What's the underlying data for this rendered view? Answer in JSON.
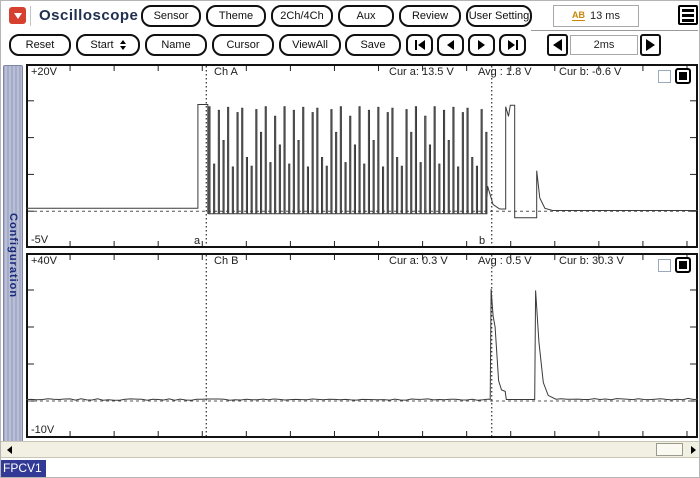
{
  "window": {
    "title": "Oscilloscope"
  },
  "toolbar_top": {
    "buttons": [
      "Sensor",
      "Theme",
      "2Ch/4Ch",
      "Aux",
      "Review",
      "User Setting"
    ],
    "time_display": {
      "icon_text": "AB",
      "value": "13 ms"
    }
  },
  "toolbar_second": {
    "buttons": [
      "Reset",
      "Start",
      "Name",
      "Cursor",
      "ViewAll",
      "Save"
    ],
    "timebase_value": "2ms"
  },
  "sidebar": {
    "tab_label": "Configuration"
  },
  "channels": [
    {
      "name": "Ch A",
      "v_top_label": "+20V",
      "v_bottom_label": "-5V",
      "cur_a_label": "Cur a: 13.5 V",
      "avg_label": "Avg : 1.8 V",
      "cur_b_label": "Cur b: -0.6 V",
      "cursor_a_tag": "a",
      "cursor_b_tag": "b"
    },
    {
      "name": "Ch B",
      "v_top_label": "+40V",
      "v_bottom_label": "-10V",
      "cur_a_label": "Cur a: 0.3 V",
      "avg_label": "Avg : 0.5 V",
      "cur_b_label": "Cur b: 30.3 V"
    }
  ],
  "status_bar": {
    "device_label": "FPCV1"
  },
  "colors": {
    "accent_red": "#d6402e",
    "icon_gold": "#c8860a",
    "badge_navy": "#333a96",
    "trace": "#3a3a3a"
  },
  "chart_data": [
    {
      "type": "line",
      "name": "Ch A",
      "unit_x": "ms",
      "unit_y": "V",
      "x_range": [
        0,
        30.5
      ],
      "y_range": [
        -5,
        20
      ],
      "timebase": "2ms/div",
      "cursor_a_ms": 8.18,
      "cursor_b_ms": 21.14,
      "zero_line_v": 0,
      "pre_points": [
        [
          0,
          0.4
        ],
        [
          7.8,
          0.4
        ],
        [
          7.8,
          14.5
        ],
        [
          8.25,
          14.5
        ],
        [
          8.25,
          -0.3
        ]
      ],
      "burst": {
        "start_ms": 8.3,
        "end_ms": 20.88,
        "low_v": -0.35,
        "pulse_width_ms": 0.05,
        "gap_ms": 0.163,
        "heights_v": [
          14.2,
          6.4,
          13.7,
          9.6,
          14.1,
          6.0,
          13.4,
          14.0,
          7.3,
          6.1,
          13.8,
          10.7,
          14.2,
          6.6,
          12.9,
          9.0
        ]
      },
      "post_points": [
        [
          20.95,
          3.4
        ],
        [
          21.2,
          0.9
        ],
        [
          21.5,
          0.3
        ],
        [
          21.77,
          0.3
        ],
        [
          21.77,
          14.2
        ],
        [
          21.9,
          12.9
        ],
        [
          21.98,
          14.4
        ],
        [
          22.18,
          14.4
        ],
        [
          22.18,
          -0.9
        ],
        [
          23.18,
          -0.9
        ],
        [
          23.18,
          5.5
        ],
        [
          23.32,
          1.8
        ],
        [
          23.55,
          0.4
        ],
        [
          23.9,
          0.1
        ],
        [
          30.5,
          0.1
        ]
      ]
    },
    {
      "type": "line",
      "name": "Ch B",
      "unit_x": "ms",
      "unit_y": "V",
      "x_range": [
        0,
        30.5
      ],
      "y_range": [
        -10,
        40
      ],
      "timebase": "2ms/div",
      "cursor_a_ms": 8.18,
      "cursor_b_ms": 21.14,
      "zero_line_v": 0,
      "noise_v": 0.4,
      "points": [
        [
          0,
          0.4
        ],
        [
          21.07,
          0.4
        ],
        [
          21.11,
          30.3
        ],
        [
          21.2,
          23
        ],
        [
          21.29,
          20
        ],
        [
          21.45,
          5.5
        ],
        [
          21.58,
          3.0
        ],
        [
          21.75,
          2.6
        ],
        [
          21.8,
          0.4
        ],
        [
          23.05,
          0.4
        ],
        [
          23.09,
          0.4
        ],
        [
          23.13,
          29.9
        ],
        [
          23.28,
          16.0
        ],
        [
          23.48,
          5.0
        ],
        [
          23.7,
          1.5
        ],
        [
          24.05,
          0.5
        ],
        [
          30.5,
          0.5
        ]
      ]
    }
  ]
}
